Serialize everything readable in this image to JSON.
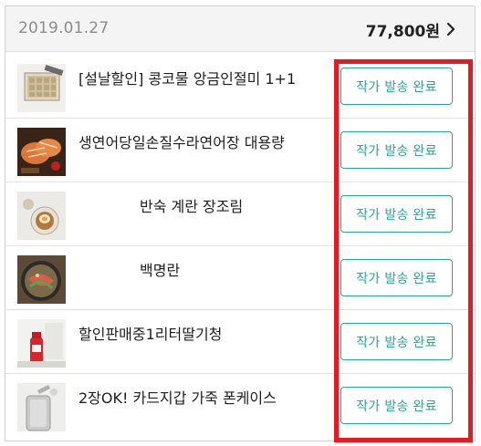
{
  "order": {
    "date": "2019.01.27",
    "total": "77,800원"
  },
  "items": [
    {
      "title": "[설날할인] 콩코물 앙금인절미 1+1",
      "status": "작가 발송 완료"
    },
    {
      "title": "생연어당일손질수라연어장 대용량",
      "status": "작가 발송 완료"
    },
    {
      "title": "반숙 계란 장조림",
      "status": "작가 발송 완료"
    },
    {
      "title": "백명란",
      "status": "작가 발송 완료"
    },
    {
      "title": "할인판매중1리터딸기청",
      "status": "작가 발송 완료"
    },
    {
      "title": "2장OK! 카드지갑 가죽 폰케이스",
      "status": "작가 발송 완료"
    }
  ],
  "colors": {
    "accent": "#2aa39a",
    "highlight": "#e31b23"
  },
  "icons": {
    "header_arrow": "chevron-right-icon"
  }
}
